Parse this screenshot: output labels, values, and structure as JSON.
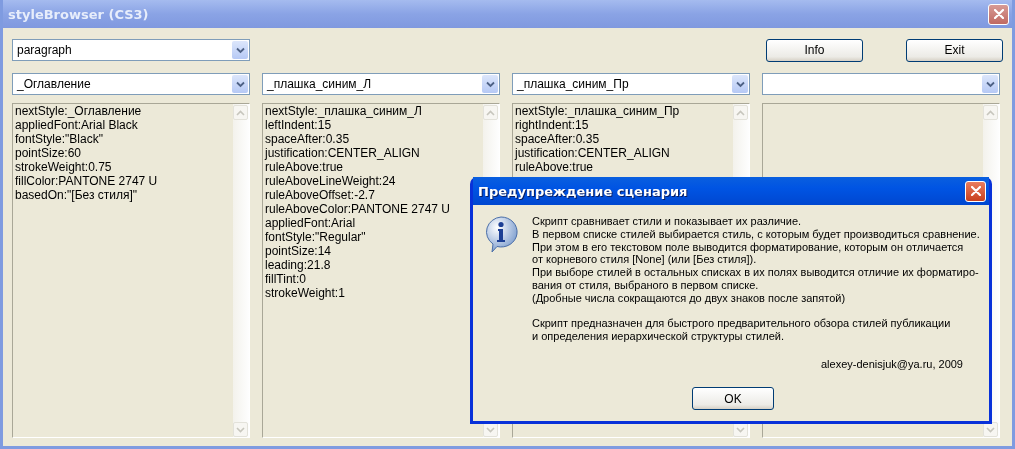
{
  "window": {
    "title": "styleBrowser (CS3)"
  },
  "style_type": {
    "value": "paragraph"
  },
  "buttons": [
    "Info",
    "Exit"
  ],
  "columns": [
    {
      "kind": "filled",
      "style": "_Оглавление",
      "lines": [
        "nextStyle:_Оглавление",
        "appliedFont:Arial Black",
        "fontStyle:\"Black\"",
        "pointSize:60",
        "strokeWeight:0.75",
        "fillColor:PANTONE 2747 U",
        "basedOn:\"[Без стиля]\""
      ]
    },
    {
      "kind": "filled",
      "style": "_плашка_синим_Л",
      "lines": [
        "nextStyle:_плашка_синим_Л",
        "leftIndent:15",
        "spaceAfter:0.35",
        "justification:CENTER_ALIGN",
        "ruleAbove:true",
        "ruleAboveLineWeight:24",
        "ruleAboveOffset:-2.7",
        "ruleAboveColor:PANTONE 2747 U",
        "appliedFont:Arial",
        "fontStyle:\"Regular\"",
        "pointSize:14",
        "leading:21.8",
        "fillTint:0",
        "strokeWeight:1"
      ]
    },
    {
      "kind": "filled",
      "style": "_плашка_синим_Пр",
      "lines": [
        "nextStyle:_плашка_синим_Пр",
        "rightIndent:15",
        "spaceAfter:0.35",
        "justification:CENTER_ALIGN",
        "ruleAbove:true"
      ]
    },
    {
      "kind": "empty"
    }
  ],
  "dialog": {
    "title": "Предупреждение сценария",
    "paragraphs": [
      [
        "Скрипт сравнивает стили и показывает их различие.",
        "В первом списке стилей выбирается стиль, с которым будет производиться сравнение.",
        "При этом в его текстовом поле выводится форматирование, которым он отличается",
        "от корневого стиля [None] (или [Без стиля]).",
        "При выборе стилей в остальных списках в их полях выводится отличие их форматиро-",
        "вания от стиля, выбраного в первом списке.",
        "(Дробные числа сокращаются до двух знаков после запятой)"
      ],
      [
        "Скрипт предназначен для быстрого предварительного обзора стилей публикации",
        "и определения иерархической структуры стилей."
      ]
    ],
    "signature": "alexey-denisjuk@ya.ru, 2009",
    "button": "OK"
  }
}
